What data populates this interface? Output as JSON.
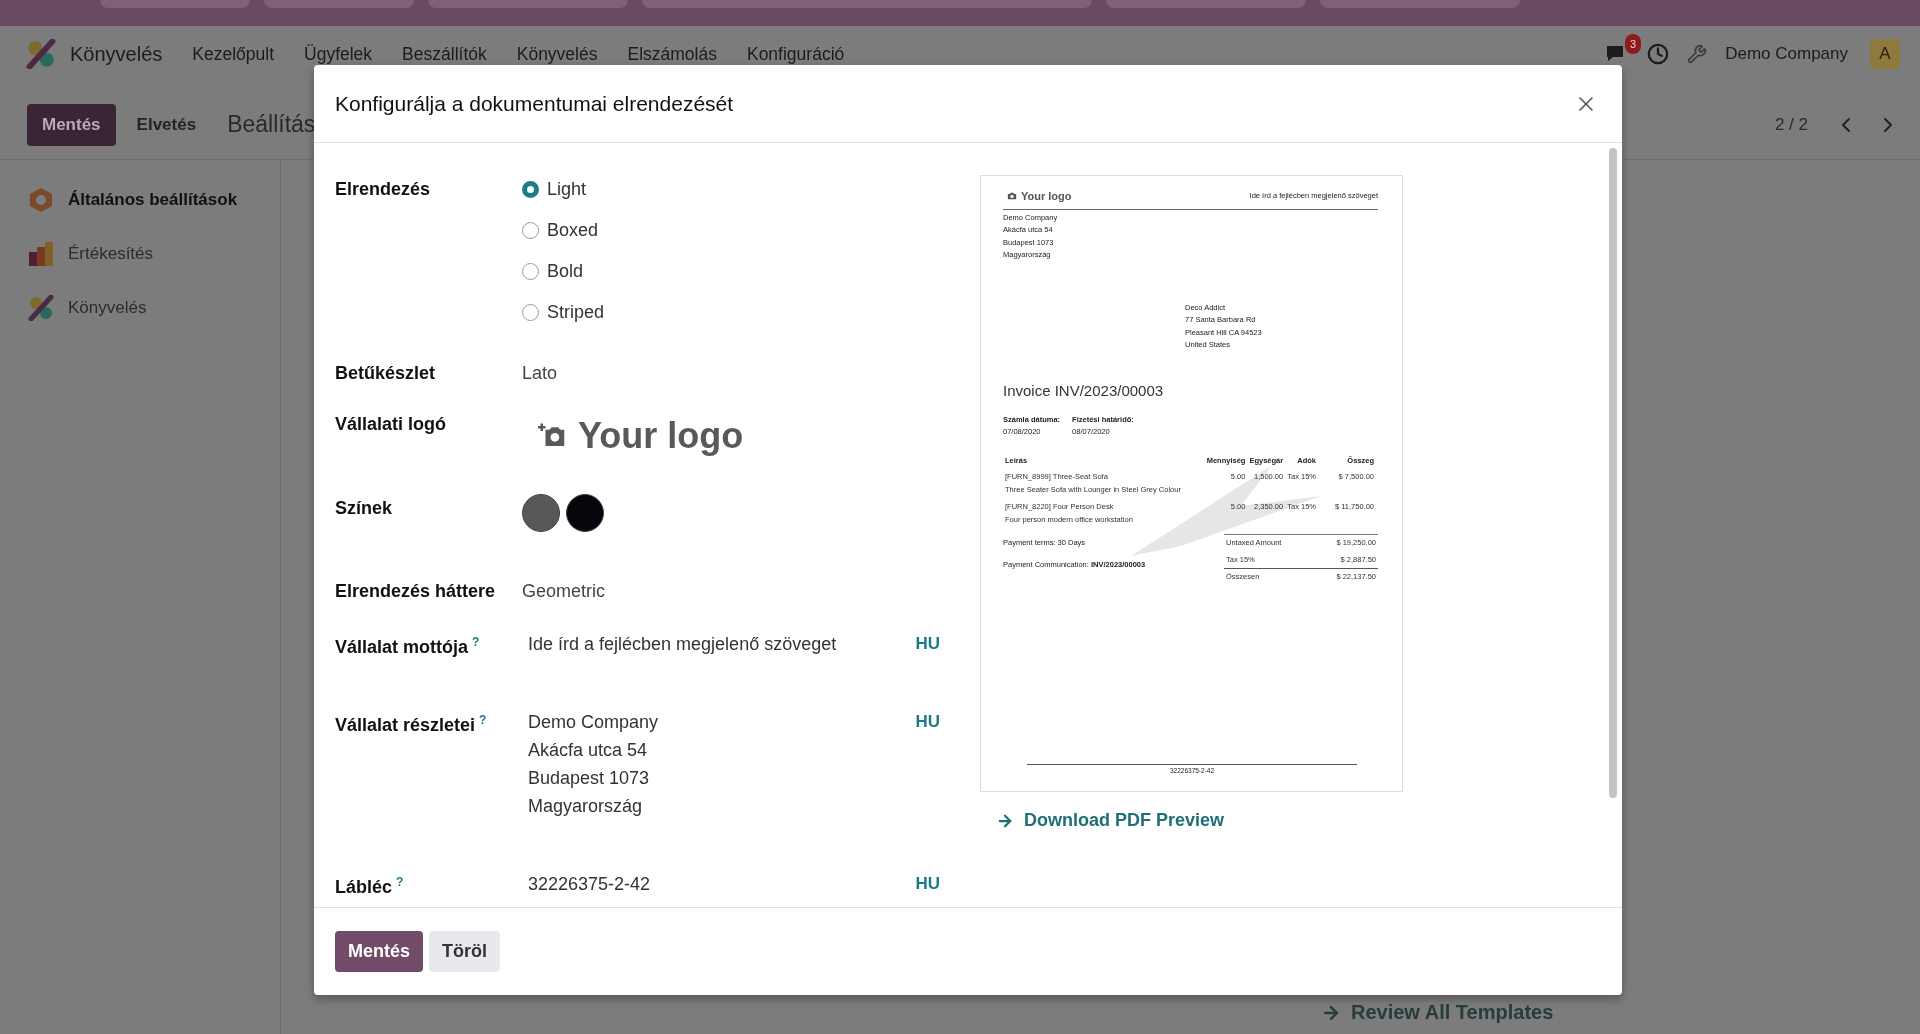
{
  "navbar": {
    "app_name": "Könyvelés",
    "menu": [
      "Kezelőpult",
      "Ügyfelek",
      "Beszállítók",
      "Könyvelés",
      "Elszámolás",
      "Konfiguráció"
    ],
    "notification_count": "3",
    "company": "Demo Company",
    "avatar": "A"
  },
  "control_panel": {
    "buttons": [
      {
        "label": "Mentés",
        "primary": true
      },
      {
        "label": "Elvetés",
        "primary": false
      }
    ],
    "title": "Beállítás",
    "pager": "2 / 2"
  },
  "sidebar": {
    "items": [
      {
        "label": "Általános beállítások",
        "selected": true
      },
      {
        "label": "Értékesítés",
        "selected": false
      },
      {
        "label": "Könyvelés",
        "selected": false
      }
    ]
  },
  "background_link": "Review All Templates",
  "dialog": {
    "title": "Konfigurálja a dokumentumai elrendezését",
    "fields": [
      {
        "kind": "radio",
        "label": "Elrendezés",
        "options": [
          {
            "label": "Light",
            "selected": true
          },
          {
            "label": "Boxed",
            "selected": false
          },
          {
            "label": "Bold",
            "selected": false
          },
          {
            "label": "Striped",
            "selected": false
          }
        ]
      },
      {
        "kind": "text",
        "label": "Betűkészlet",
        "value": "Lato"
      },
      {
        "kind": "logo",
        "label": "Vállalati logó",
        "value": "Your logo"
      },
      {
        "kind": "colors",
        "label": "Színek",
        "colors": [
          {
            "color": "#58585a"
          },
          {
            "color": "#05070c"
          }
        ]
      },
      {
        "kind": "text",
        "label": "Elrendezés háttere",
        "value": "Geometric"
      },
      {
        "kind": "translatable",
        "label": "Vállalat mottója",
        "help": "?",
        "lines": [
          "Ide írd a fejlécben megjelenő szöveget"
        ],
        "lang": "HU"
      },
      {
        "kind": "translatable",
        "label": "Vállalat részletei",
        "help": "?",
        "lines": [
          "Demo Company",
          "Akácfa utca 54",
          "Budapest 1073",
          "Magyarország"
        ],
        "lang": "HU"
      },
      {
        "kind": "translatable",
        "label": "Lábléc",
        "help": "?",
        "lines": [
          "32226375-2-42"
        ],
        "lang": "HU"
      }
    ],
    "preview": {
      "logo": "Your logo",
      "motto": "Ide írd a fejlécben megjelenő szöveget",
      "company_lines": [
        "Demo Company",
        "Akácfa utca 54",
        "Budapest 1073",
        "Magyarország"
      ],
      "partner_lines": [
        "Deco Addict",
        "77 Santa Barbara Rd",
        "Pleasant Hill CA 94523",
        "United States"
      ],
      "title": "Invoice INV/2023/00003",
      "dates": [
        {
          "label": "Számla dátuma:",
          "value": "07/08/2020"
        },
        {
          "label": "Fizetési határidő:",
          "value": "08/07/2020"
        }
      ],
      "columns": [
        "Leírás",
        "Mennyiség",
        "Egységár",
        "Adók",
        "Összeg"
      ],
      "lines": [
        {
          "name": "[FURN_8999] Three-Seat Sofa",
          "description": "Three Seater Sofa with Lounger in Steel Grey Colour",
          "quantity": "5.00",
          "price": "1,500.00",
          "tax": "Tax 15%",
          "amount": "$ 7,500.00"
        },
        {
          "name": "[FURN_8220] Four Person Desk",
          "description": "Four person modern office workstation",
          "quantity": "5.00",
          "price": "2,350.00",
          "tax": "Tax 15%",
          "amount": "$ 11,750.00"
        }
      ],
      "notes": [
        "Payment terms: 30 Days",
        "Payment Communication: **INV/2023/00003**"
      ],
      "totals": [
        {
          "kind": "subtotal",
          "label": "Untaxed Amount",
          "value": "$ 19,250.00"
        },
        {
          "kind": "subtotal",
          "label": "Tax 15%",
          "value": "$ 2,887.50"
        },
        {
          "kind": "total",
          "label": "Összesen",
          "value": "$ 22,137.50"
        }
      ],
      "footer": "32226375-2-42"
    },
    "download_link": "Download PDF Preview",
    "footer_buttons": [
      {
        "label": "Mentés",
        "primary": true
      },
      {
        "label": "Töröl",
        "primary": false
      }
    ]
  }
}
